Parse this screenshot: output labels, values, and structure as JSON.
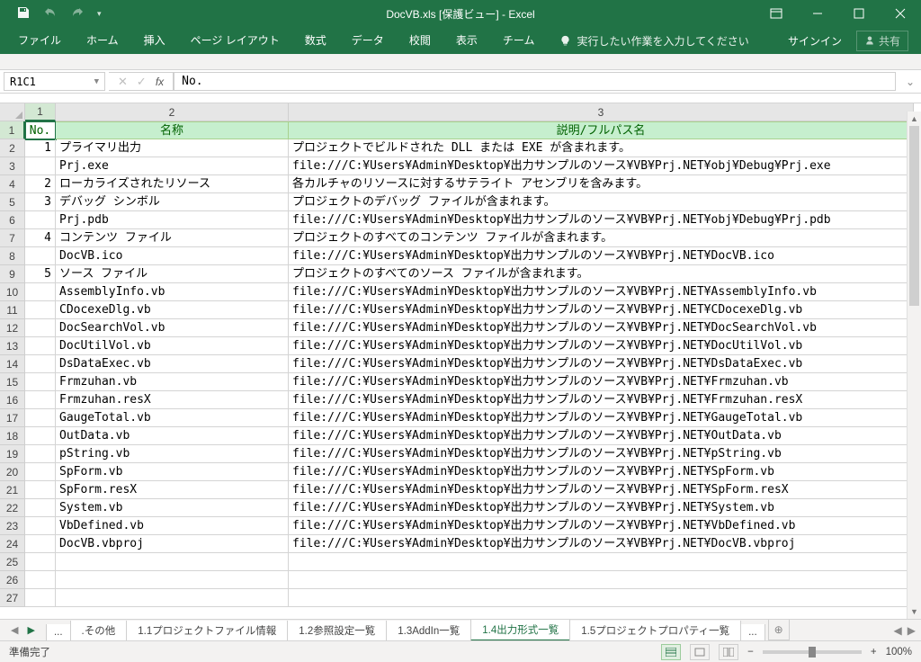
{
  "titlebar": {
    "title": "DocVB.xls  [保護ビュー] - Excel"
  },
  "ribbon": {
    "tabs": [
      "ファイル",
      "ホーム",
      "挿入",
      "ページ レイアウト",
      "数式",
      "データ",
      "校閲",
      "表示",
      "チーム"
    ],
    "tellme": "実行したい作業を入力してください",
    "signin": "サインイン",
    "share": "共有"
  },
  "formula_bar": {
    "name_box": "R1C1",
    "formula": "No."
  },
  "columns": [
    "1",
    "2",
    "3"
  ],
  "header_row": {
    "c1": "No.",
    "c2": "名称",
    "c3": "説明/フルパス名"
  },
  "rows": [
    {
      "r": "1",
      "no": "",
      "name": "No.",
      "desc": ""
    },
    {
      "r": "2",
      "no": "1",
      "name": "プライマリ出力",
      "desc": "プロジェクトでビルドされた DLL または EXE が含まれます。"
    },
    {
      "r": "3",
      "no": "",
      "name": "Prj.exe",
      "desc": "file:///C:¥Users¥Admin¥Desktop¥出力サンプルのソース¥VB¥Prj.NET¥obj¥Debug¥Prj.exe"
    },
    {
      "r": "4",
      "no": "2",
      "name": "ローカライズされたリソース",
      "desc": "各カルチャのリソースに対するサテライト アセンブリを含みます。"
    },
    {
      "r": "5",
      "no": "3",
      "name": "デバッグ シンボル",
      "desc": "プロジェクトのデバッグ ファイルが含まれます。"
    },
    {
      "r": "6",
      "no": "",
      "name": "Prj.pdb",
      "desc": "file:///C:¥Users¥Admin¥Desktop¥出力サンプルのソース¥VB¥Prj.NET¥obj¥Debug¥Prj.pdb"
    },
    {
      "r": "7",
      "no": "4",
      "name": "コンテンツ ファイル",
      "desc": "プロジェクトのすべてのコンテンツ ファイルが含まれます。"
    },
    {
      "r": "8",
      "no": "",
      "name": "DocVB.ico",
      "desc": "file:///C:¥Users¥Admin¥Desktop¥出力サンプルのソース¥VB¥Prj.NET¥DocVB.ico"
    },
    {
      "r": "9",
      "no": "5",
      "name": "ソース ファイル",
      "desc": "プロジェクトのすべてのソース ファイルが含まれます。"
    },
    {
      "r": "10",
      "no": "",
      "name": "AssemblyInfo.vb",
      "desc": "file:///C:¥Users¥Admin¥Desktop¥出力サンプルのソース¥VB¥Prj.NET¥AssemblyInfo.vb"
    },
    {
      "r": "11",
      "no": "",
      "name": "CDocexeDlg.vb",
      "desc": "file:///C:¥Users¥Admin¥Desktop¥出力サンプルのソース¥VB¥Prj.NET¥CDocexeDlg.vb"
    },
    {
      "r": "12",
      "no": "",
      "name": "DocSearchVol.vb",
      "desc": "file:///C:¥Users¥Admin¥Desktop¥出力サンプルのソース¥VB¥Prj.NET¥DocSearchVol.vb"
    },
    {
      "r": "13",
      "no": "",
      "name": "DocUtilVol.vb",
      "desc": "file:///C:¥Users¥Admin¥Desktop¥出力サンプルのソース¥VB¥Prj.NET¥DocUtilVol.vb"
    },
    {
      "r": "14",
      "no": "",
      "name": "DsDataExec.vb",
      "desc": "file:///C:¥Users¥Admin¥Desktop¥出力サンプルのソース¥VB¥Prj.NET¥DsDataExec.vb"
    },
    {
      "r": "15",
      "no": "",
      "name": "Frmzuhan.vb",
      "desc": "file:///C:¥Users¥Admin¥Desktop¥出力サンプルのソース¥VB¥Prj.NET¥Frmzuhan.vb"
    },
    {
      "r": "16",
      "no": "",
      "name": "Frmzuhan.resX",
      "desc": "file:///C:¥Users¥Admin¥Desktop¥出力サンプルのソース¥VB¥Prj.NET¥Frmzuhan.resX"
    },
    {
      "r": "17",
      "no": "",
      "name": "GaugeTotal.vb",
      "desc": "file:///C:¥Users¥Admin¥Desktop¥出力サンプルのソース¥VB¥Prj.NET¥GaugeTotal.vb"
    },
    {
      "r": "18",
      "no": "",
      "name": "OutData.vb",
      "desc": "file:///C:¥Users¥Admin¥Desktop¥出力サンプルのソース¥VB¥Prj.NET¥OutData.vb"
    },
    {
      "r": "19",
      "no": "",
      "name": "pString.vb",
      "desc": "file:///C:¥Users¥Admin¥Desktop¥出力サンプルのソース¥VB¥Prj.NET¥pString.vb"
    },
    {
      "r": "20",
      "no": "",
      "name": "SpForm.vb",
      "desc": "file:///C:¥Users¥Admin¥Desktop¥出力サンプルのソース¥VB¥Prj.NET¥SpForm.vb"
    },
    {
      "r": "21",
      "no": "",
      "name": "SpForm.resX",
      "desc": "file:///C:¥Users¥Admin¥Desktop¥出力サンプルのソース¥VB¥Prj.NET¥SpForm.resX"
    },
    {
      "r": "22",
      "no": "",
      "name": "System.vb",
      "desc": "file:///C:¥Users¥Admin¥Desktop¥出力サンプルのソース¥VB¥Prj.NET¥System.vb"
    },
    {
      "r": "23",
      "no": "",
      "name": "VbDefined.vb",
      "desc": "file:///C:¥Users¥Admin¥Desktop¥出力サンプルのソース¥VB¥Prj.NET¥VbDefined.vb"
    },
    {
      "r": "24",
      "no": "",
      "name": "DocVB.vbproj",
      "desc": "file:///C:¥Users¥Admin¥Desktop¥出力サンプルのソース¥VB¥Prj.NET¥DocVB.vbproj"
    },
    {
      "r": "25",
      "no": "",
      "name": "",
      "desc": ""
    },
    {
      "r": "26",
      "no": "",
      "name": "",
      "desc": ""
    },
    {
      "r": "27",
      "no": "",
      "name": "",
      "desc": ""
    }
  ],
  "sheet_tabs": {
    "ellipsis_left": "...",
    "tabs": [
      ".その他",
      "1.1プロジェクトファイル情報",
      "1.2参照設定一覧",
      "1.3AddIn一覧",
      "1.4出力形式一覧",
      "1.5プロジェクトプロパティ一覧"
    ],
    "active_index": 4,
    "ellipsis_right": "..."
  },
  "status_bar": {
    "ready": "準備完了",
    "zoom": "100%"
  }
}
